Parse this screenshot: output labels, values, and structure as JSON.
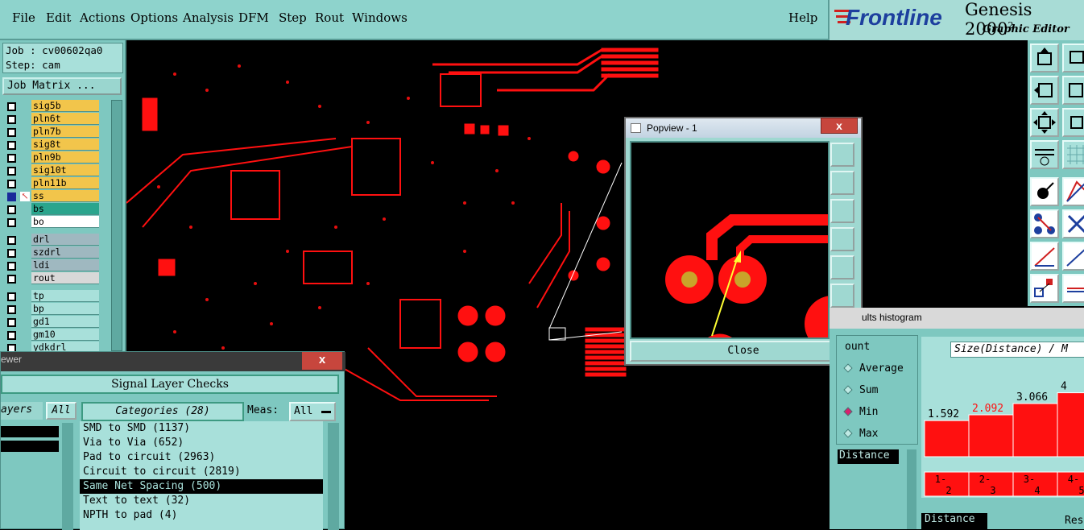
{
  "menu": {
    "items": [
      "File",
      "Edit",
      "Actions",
      "Options",
      "Analysis",
      "DFM",
      "Step",
      "Rout",
      "Windows"
    ],
    "help": "Help"
  },
  "logo": {
    "brand": "Frontline",
    "product": "Genesis 2000",
    "sup": "2",
    "subtitle": "Graphic Editor"
  },
  "job": {
    "job_line": "Job : cv00602qa0",
    "step_line": "Step: cam",
    "matrix_button": "Job Matrix ..."
  },
  "layers": [
    {
      "name": "sig5b",
      "color": "#f2c54b",
      "checked": false
    },
    {
      "name": "pln6t",
      "color": "#f2c54b",
      "checked": false
    },
    {
      "name": "pln7b",
      "color": "#f2c54b",
      "checked": false
    },
    {
      "name": "sig8t",
      "color": "#f2c54b",
      "checked": false
    },
    {
      "name": "pln9b",
      "color": "#f2c54b",
      "checked": false
    },
    {
      "name": "sig10t",
      "color": "#f2c54b",
      "checked": false
    },
    {
      "name": "pln11b",
      "color": "#f2c54b",
      "checked": false
    },
    {
      "name": "ss",
      "color": "#f2c54b",
      "checked": true
    },
    {
      "name": "bs",
      "color": "#2aa58d",
      "checked": false
    },
    {
      "name": "bo",
      "color": "#ffffff",
      "checked": false
    },
    {
      "name": "drl",
      "color": "#9fb8c0",
      "checked": false
    },
    {
      "name": "szdrl",
      "color": "#9fb8c0",
      "checked": false
    },
    {
      "name": "ldi",
      "color": "#9fb8c0",
      "checked": false
    },
    {
      "name": "rout",
      "color": "#d8d8d8",
      "checked": false
    },
    {
      "name": "tp",
      "color": "#a8e0da",
      "checked": false
    },
    {
      "name": "bp",
      "color": "#a8e0da",
      "checked": false
    },
    {
      "name": "gd1",
      "color": "#a8e0da",
      "checked": false
    },
    {
      "name": "gm10",
      "color": "#a8e0da",
      "checked": false
    },
    {
      "name": "ydkdrl",
      "color": "#a8e0da",
      "checked": false
    }
  ],
  "popview": {
    "title": "Popview - 1",
    "close_label": "Close",
    "x_label": "x"
  },
  "checks": {
    "window_title_fragment": "ewer",
    "close_x": "x",
    "header": "Signal Layer Checks",
    "layers_tab": "ayers",
    "all_button": "All",
    "categories_label": "Categories (28)",
    "meas_label": "Meas:",
    "meas_value": "All",
    "categories": [
      "SMD to SMD (1137)",
      "Via to Via (652)",
      "Pad to circuit (2963)",
      "Circuit to circuit (2819)",
      "Same Net Spacing (500)",
      "Text to text (32)",
      "NPTH to pad (4)"
    ],
    "selected_index": 4
  },
  "histogram": {
    "title_fragment": "ults histogram",
    "radios": [
      "ount",
      "Average",
      "Sum",
      "Min",
      "Max"
    ],
    "radio_selected": 3,
    "distance_label": "Distance",
    "size_label": "Size(Distance) / M",
    "bottom_label": "Distance",
    "bottom_right": "Res",
    "chart_data": {
      "type": "bar",
      "categories": [
        "1-2",
        "2-3",
        "3-4",
        "4-5"
      ],
      "values": [
        1.592,
        2.092,
        3.066,
        4
      ],
      "value_labels": [
        "1.592",
        "2.092",
        "3.066",
        "4"
      ],
      "highlight_index": 1
    }
  }
}
